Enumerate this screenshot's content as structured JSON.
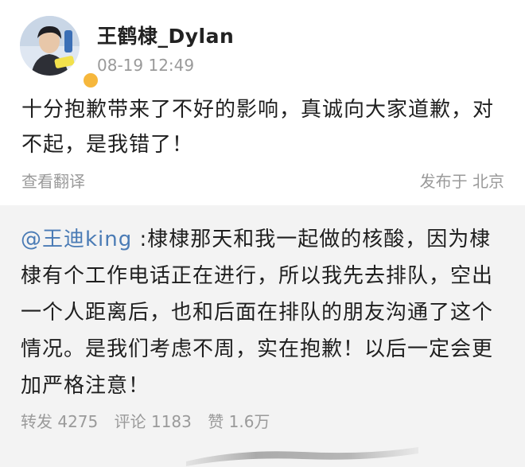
{
  "post": {
    "username": "王鹤棣_Dylan",
    "timestamp": "08-19 12:49",
    "body": "十分抱歉带来了不好的影响，真诚向大家道歉，对不起，是我错了！",
    "translate_label": "查看翻译",
    "location_label": "发布于 北京"
  },
  "repost": {
    "mention": "@王迪king",
    "body": " :棣棣那天和我一起做的核酸，因为棣棣有个工作电话正在进行，所以我先去排队，空出一个人距离后，也和后面在排队的朋友沟通了这个情况。是我们考虑不周，实在抱歉！以后一定会更加严格注意！",
    "stats": {
      "repost": "转发 4275",
      "comment": "评论 1183",
      "like": "赞 1.6万"
    }
  },
  "colors": {
    "mention": "#4a7bb5",
    "secondary_text": "#9a9a9a",
    "repost_bg": "#f3f3f3",
    "verified_badge": "#f6b73c"
  },
  "icons": {
    "avatar": "user-avatar",
    "badge": "verified-badge-icon"
  }
}
